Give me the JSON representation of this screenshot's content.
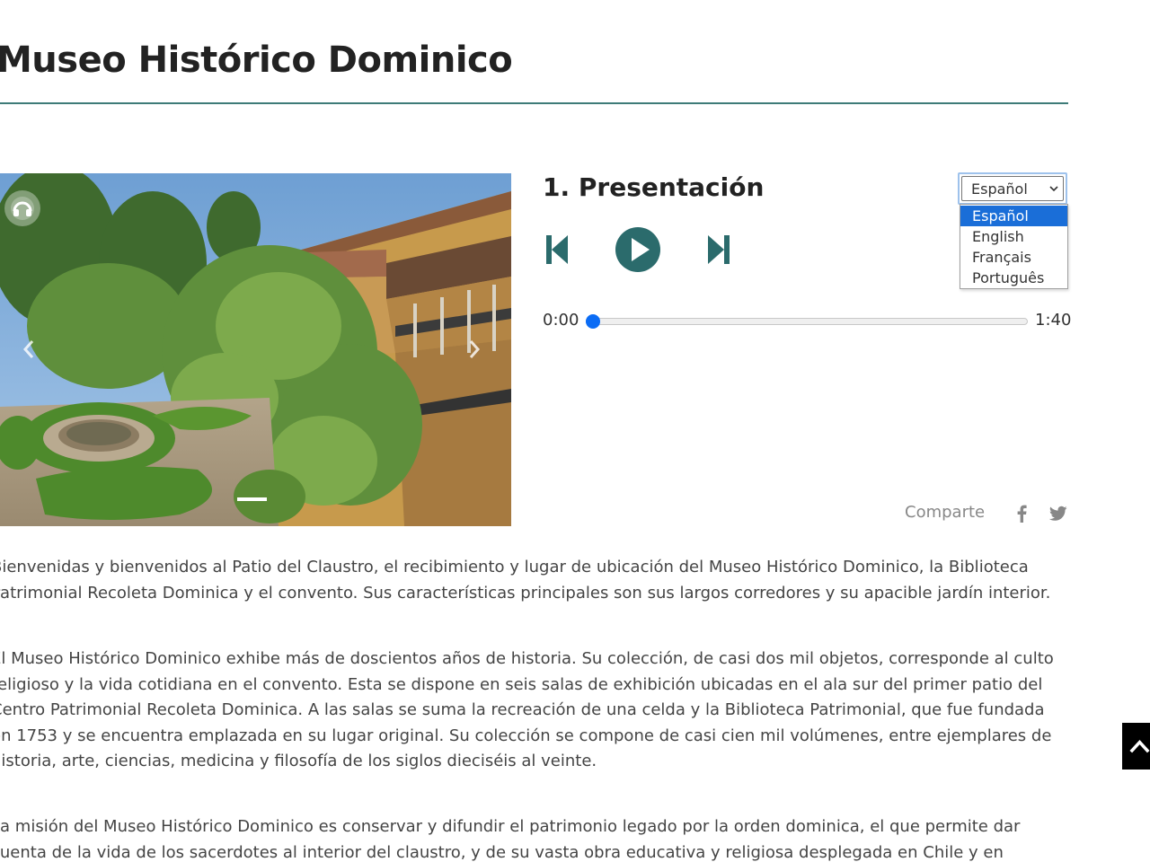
{
  "page": {
    "title": "Museo Histórico Dominico"
  },
  "colors": {
    "accent": "#3e7b78",
    "seek": "#0b6cf5",
    "text": "#444444",
    "muted": "#888888",
    "selection": "#1a6ed8"
  },
  "hero": {
    "audio_icon": "headphones-icon",
    "prev_icon": "chevron-left-icon",
    "next_icon": "chevron-right-icon",
    "slide_count": 1,
    "active_slide": 1
  },
  "player": {
    "track_title": "1. Presentación",
    "prev_icon": "skip-back-icon",
    "play_icon": "play-icon",
    "next_icon": "skip-forward-icon",
    "current_time": "0:00",
    "duration": "1:40",
    "progress": 0.0
  },
  "language": {
    "selected": "Español",
    "options": [
      "Español",
      "English",
      "Français",
      "Português"
    ],
    "chevron_icon": "chevron-down-icon"
  },
  "share": {
    "label": "Comparte",
    "facebook_icon": "facebook-icon",
    "twitter_icon": "twitter-icon"
  },
  "content": {
    "paragraphs": [
      "Bienvenidas y bienvenidos al Patio del Claustro, el recibimiento y lugar de ubicación del Museo Histórico Dominico, la Biblioteca Patrimonial Recoleta Dominica y el convento. Sus características principales son sus largos corredores y su apacible jardín interior.",
      "El Museo Histórico Dominico exhibe más de doscientos años de historia. Su colección, de casi dos mil objetos, corresponde al culto religioso y la vida cotidiana en el convento. Esta se dispone en seis salas de exhibición ubicadas en el ala sur del primer patio del Centro Patrimonial Recoleta Dominica. A las salas se suma la recreación de una celda y la Biblioteca Patrimonial, que fue fundada en 1753 y se encuentra emplazada en su lugar original. Su colección se compone de casi cien mil volúmenes, entre ejemplares de historia, arte, ciencias, medicina y filosofía de los siglos dieciséis al veinte.",
      "La misión del Museo Histórico Dominico es conservar y difundir el patrimonio legado por la orden dominica, el que permite dar cuenta de la vida de los sacerdotes al interior del claustro, y de su vasta obra educativa y religiosa desplegada en Chile y en América Latina."
    ]
  },
  "back_to_top": {
    "icon": "chevron-up-icon"
  }
}
